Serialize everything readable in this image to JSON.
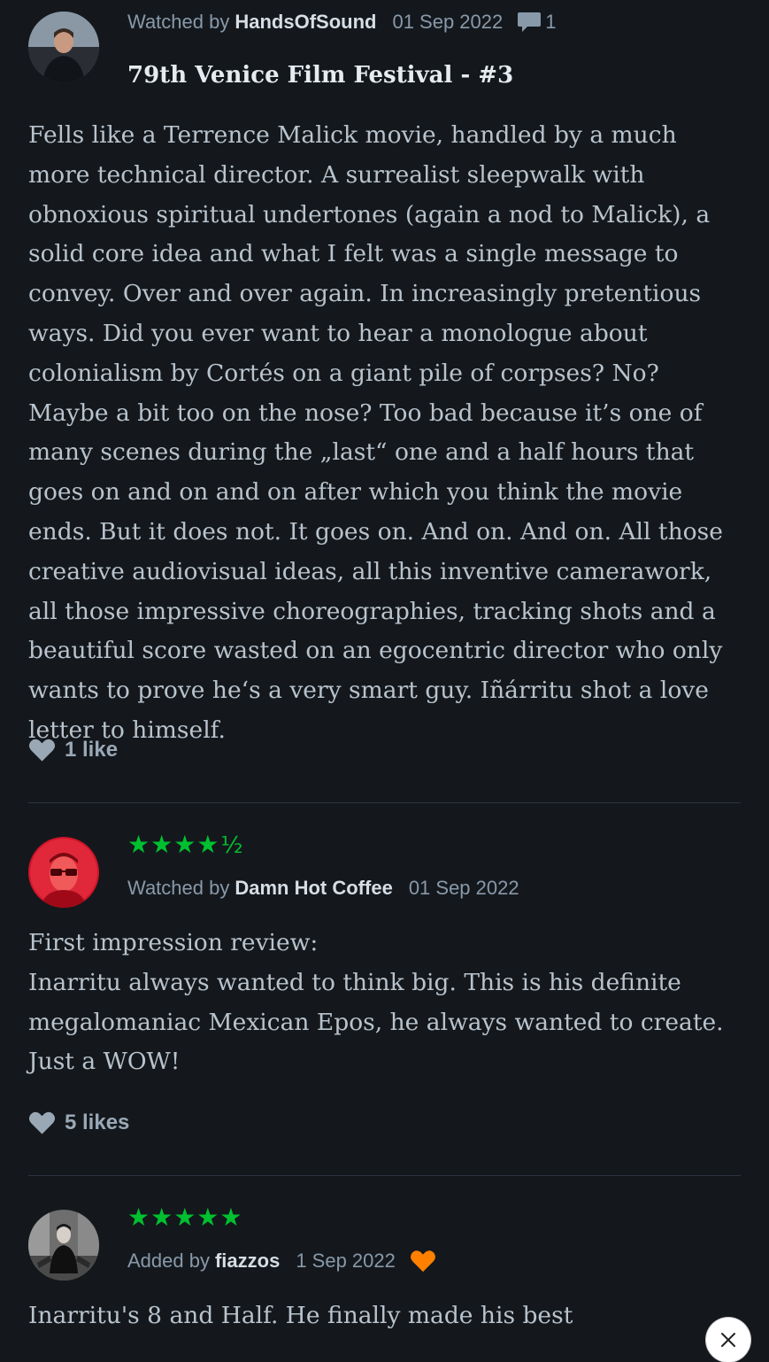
{
  "reviews": [
    {
      "action": "Watched by",
      "author": "HandsOfSound",
      "date": "01 Sep 2022",
      "comment_count": "1",
      "title": "79th Venice Film Festival - #3",
      "text": "Fells like a Terrence Malick movie, handled by a much more technical director. A surrealist sleepwalk with obnoxious spiritual undertones (again a nod to Malick), a solid core idea and what I felt was a single message to convey. Over and over again. In increasingly pretentious ways. Did you ever want to hear a monologue about colonialism by Cortés on a giant pile of corpses? No? Maybe a bit too on the nose? Too bad because it’s one of many scenes during the „last“ one and a half hours that goes on and on and on after which you think the movie ends. But it does not. It goes on. And on. And on. All those creative audiovisual ideas, all this inventive camerawork, all those impressive choreographies, tracking shots and a beautiful score wasted on an egocentric director who only wants to prove he‘s a very smart guy. Iñárritu shot a love letter to himself.",
      "likes": "1 like"
    },
    {
      "rating_stars": "★★★★",
      "rating_half": "½",
      "rating_value": 4.5,
      "action": "Watched by",
      "author": "Damn Hot Coffee",
      "date": "01 Sep 2022",
      "text_lines": [
        "First impression review:",
        "Inarritu always wanted to think big. This is his definite megalomaniac Mexican Epos, he always wanted to create. Just a WOW!"
      ],
      "likes": "5 likes"
    },
    {
      "rating_stars": "★★★★★",
      "rating_value": 5,
      "action": "Added by",
      "author": "fiazzos",
      "date": "1 Sep 2022",
      "liked": true,
      "text": "Inarritu's 8 and Half. He finally made his best"
    }
  ],
  "colors": {
    "background": "#14181c",
    "star_green": "#00c030",
    "liked_orange": "#ff8000",
    "heart_grey": "#9aa8b6"
  },
  "icons": [
    "comment-icon",
    "heart-icon",
    "liked-heart-icon",
    "close-icon"
  ]
}
